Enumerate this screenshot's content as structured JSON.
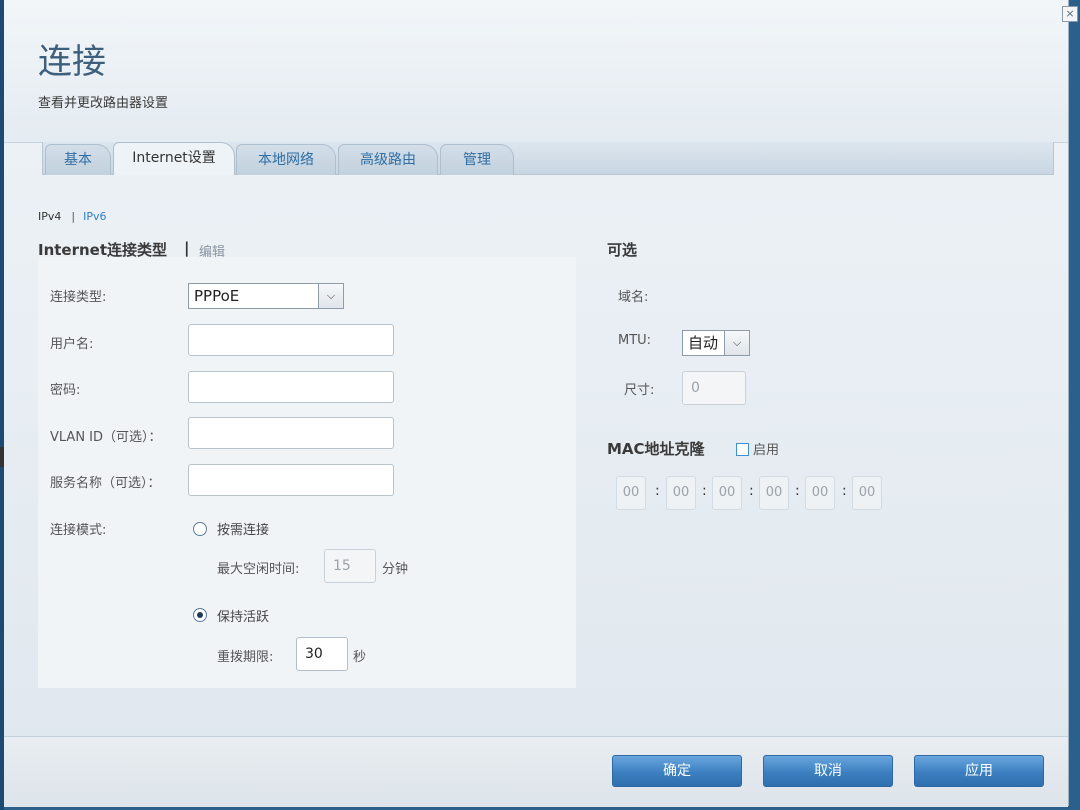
{
  "page": {
    "title": "连接",
    "subtitle": "查看并更改路由器设置",
    "close_icon": "×"
  },
  "tabs": [
    "基本",
    "Internet设置",
    "本地网络",
    "高级路由",
    "管理"
  ],
  "active_tab": "Internet设置",
  "sub_tabs": {
    "ipv4": "IPv4",
    "sep": "|",
    "ipv6": "IPv6"
  },
  "internet": {
    "section_title": "Internet连接类型",
    "sep": "|",
    "edit_link": "编辑",
    "type_label": "连接类型:",
    "type_value": "PPPoE",
    "username_label": "用户名:",
    "username_value": "",
    "password_label": "密码:",
    "password_value": "",
    "vlan_label": "VLAN ID（可选）：",
    "vlan_value": "",
    "service_label": "服务名称（可选）：",
    "service_value": "",
    "mode_label": "连接模式:",
    "on_demand_label": "按需连接",
    "max_idle_label": "最大空闲时间:",
    "max_idle_value": "15",
    "max_idle_unit": "分钟",
    "keep_alive_label": "保持活跃",
    "redial_label": "重拨期限:",
    "redial_value": "30",
    "redial_unit": "秒",
    "selected_mode": "keep_alive"
  },
  "optional": {
    "title": "可选",
    "domain_label": "域名:",
    "mtu_label": "MTU:",
    "mtu_value": "自动",
    "size_label": "尺寸:",
    "size_value": "0"
  },
  "mac_clone": {
    "title": "MAC地址克隆",
    "enable_label": "启用",
    "enabled": false,
    "octets": [
      "00",
      "00",
      "00",
      "00",
      "00",
      "00"
    ],
    "sep": ":"
  },
  "buttons": {
    "ok": "确定",
    "cancel": "取消",
    "apply": "应用"
  },
  "colors": {
    "accent": "#3c7fc0",
    "title": "#3d5f7e",
    "link": "#2f7fc4"
  }
}
